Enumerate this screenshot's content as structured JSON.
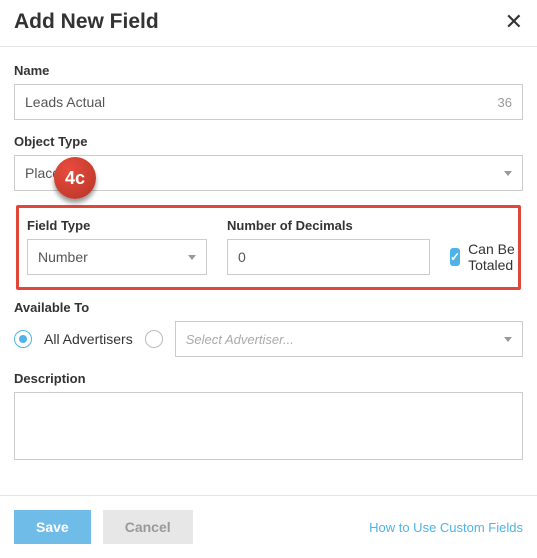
{
  "dialog": {
    "title": "Add New Field"
  },
  "name": {
    "label": "Name",
    "value": "Leads Actual",
    "remaining": "36"
  },
  "objectType": {
    "label": "Object Type",
    "value": "Placement"
  },
  "fieldType": {
    "label": "Field Type",
    "value": "Number"
  },
  "decimals": {
    "label": "Number of Decimals",
    "value": "0"
  },
  "canBeTotaled": {
    "label": "Can Be Totaled"
  },
  "availableTo": {
    "label": "Available To",
    "allLabel": "All Advertisers",
    "selectPlaceholder": "Select Advertiser..."
  },
  "description": {
    "label": "Description"
  },
  "footer": {
    "save": "Save",
    "cancel": "Cancel",
    "helpLink": "How to Use Custom Fields"
  },
  "annotation": {
    "badge": "4c"
  }
}
